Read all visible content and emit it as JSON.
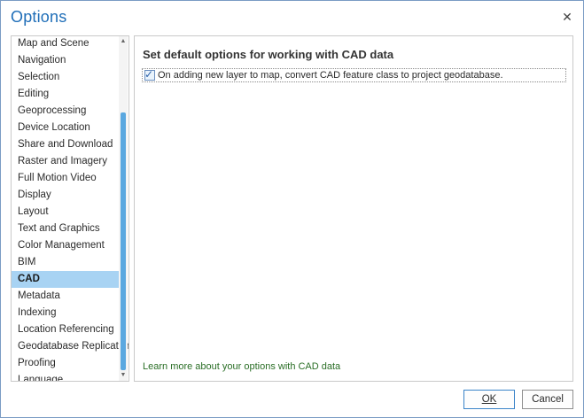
{
  "window": {
    "title": "Options",
    "close_glyph": "✕"
  },
  "nav": {
    "items": [
      {
        "label": "Map and Scene",
        "selected": false
      },
      {
        "label": "Navigation",
        "selected": false
      },
      {
        "label": "Selection",
        "selected": false
      },
      {
        "label": "Editing",
        "selected": false
      },
      {
        "label": "Geoprocessing",
        "selected": false
      },
      {
        "label": "Device Location",
        "selected": false
      },
      {
        "label": "Share and Download",
        "selected": false
      },
      {
        "label": "Raster and Imagery",
        "selected": false
      },
      {
        "label": "Full Motion Video",
        "selected": false
      },
      {
        "label": "Display",
        "selected": false
      },
      {
        "label": "Layout",
        "selected": false
      },
      {
        "label": "Text and Graphics",
        "selected": false
      },
      {
        "label": "Color Management",
        "selected": false
      },
      {
        "label": "BIM",
        "selected": false
      },
      {
        "label": "CAD",
        "selected": true
      },
      {
        "label": "Metadata",
        "selected": false
      },
      {
        "label": "Indexing",
        "selected": false
      },
      {
        "label": "Location Referencing",
        "selected": false
      },
      {
        "label": "Geodatabase Replication",
        "selected": false
      },
      {
        "label": "Proofing",
        "selected": false
      },
      {
        "label": "Language",
        "selected": false
      }
    ],
    "scroll_up_glyph": "▲",
    "scroll_down_glyph": "▼"
  },
  "panel": {
    "heading": "Set default options for working with CAD data",
    "option": {
      "label": "On adding new layer to map, convert CAD feature class to project geodatabase.",
      "checked": true,
      "check_glyph": "✓"
    },
    "learn_more": "Learn more about your options with CAD data"
  },
  "buttons": {
    "ok": "OK",
    "cancel": "Cancel"
  },
  "colors": {
    "title": "#1f6eb8",
    "selected_bg": "#a8d3f3",
    "scroll_thumb": "#5ba8e0",
    "link": "#2a6e26"
  }
}
